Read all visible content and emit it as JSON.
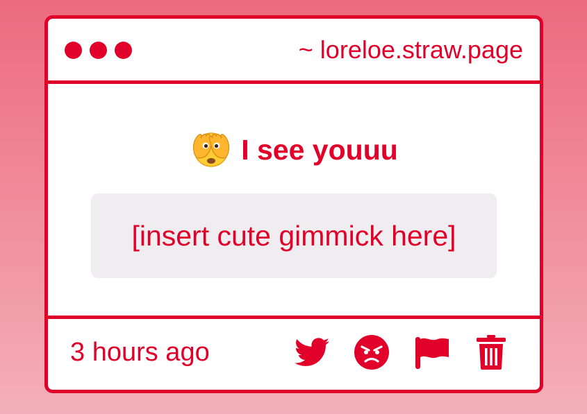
{
  "window": {
    "url": "~ loreloe.straw.page"
  },
  "post": {
    "heading_icon": "face-with-peeking-eye-emoji",
    "heading": "I see youuu",
    "gimmick": "[insert cute gimmick here]",
    "timestamp": "3 hours ago"
  },
  "actions": [
    {
      "icon": "twitter-icon"
    },
    {
      "icon": "angry-face-icon"
    },
    {
      "icon": "flag-icon"
    },
    {
      "icon": "trash-icon"
    }
  ],
  "colors": {
    "accent": "#e0002a",
    "background_top": "#ec6a7e",
    "background_bottom": "#f4b0ba",
    "gimmick_background": "#efedef",
    "window_background": "#ffffff"
  }
}
